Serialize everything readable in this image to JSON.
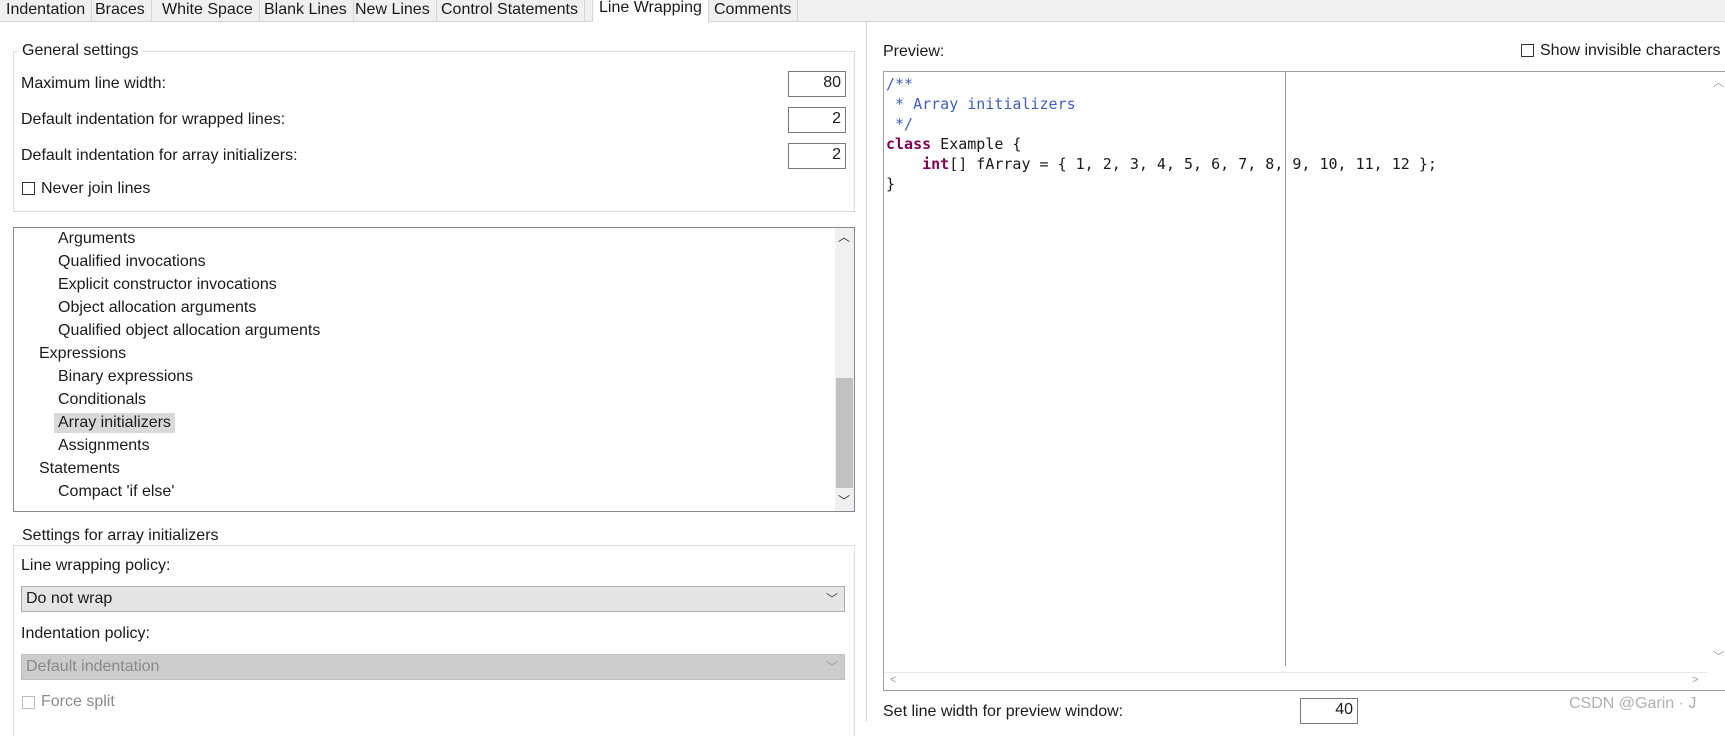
{
  "tabs": [
    {
      "label": "Indentation"
    },
    {
      "label": "Braces"
    },
    {
      "label": "White Space"
    },
    {
      "label": "Blank Lines"
    },
    {
      "label": "New Lines"
    },
    {
      "label": "Control Statements"
    },
    {
      "label": "Line Wrapping"
    },
    {
      "label": "Comments"
    }
  ],
  "active_tab": "Line Wrapping",
  "general": {
    "title": "General settings",
    "max_width_label": "Maximum line width:",
    "max_width_value": "80",
    "wrapped_indent_label": "Default indentation for wrapped lines:",
    "wrapped_indent_value": "2",
    "array_indent_label": "Default indentation for array initializers:",
    "array_indent_value": "2",
    "never_join_label": "Never join lines",
    "never_join_checked": false
  },
  "tree": {
    "items": [
      {
        "label": "Arguments",
        "level": 2
      },
      {
        "label": "Qualified invocations",
        "level": 2
      },
      {
        "label": "Explicit constructor invocations",
        "level": 2
      },
      {
        "label": "Object allocation arguments",
        "level": 2
      },
      {
        "label": "Qualified object allocation arguments",
        "level": 2
      },
      {
        "label": "Expressions",
        "level": 1
      },
      {
        "label": "Binary expressions",
        "level": 2
      },
      {
        "label": "Conditionals",
        "level": 2
      },
      {
        "label": "Array initializers",
        "level": 2,
        "selected": true
      },
      {
        "label": "Assignments",
        "level": 2
      },
      {
        "label": "Statements",
        "level": 1
      },
      {
        "label": "Compact 'if else'",
        "level": 2
      }
    ]
  },
  "array_settings": {
    "title": "Settings for array initializers",
    "policy_label": "Line wrapping policy:",
    "policy_value": "Do not wrap",
    "indent_policy_label": "Indentation policy:",
    "indent_policy_value": "Default indentation",
    "force_split_label": "Force split"
  },
  "preview": {
    "label": "Preview:",
    "show_invisible_label": "Show invisible characters",
    "code": {
      "c1": "/**",
      "c2": " * Array initializers",
      "c3": " */",
      "kw_class": "class",
      "class_rest": " Example {",
      "indent": "    ",
      "kw_int": "int",
      "int_rest": "[] fArray = { 1, 2, 3, 4, 5, 6, 7, 8, 9, 10, 11, 12 };",
      "close": "}"
    },
    "line_width_label": "Set line width for preview window:",
    "line_width_value": "40"
  },
  "watermark": "CSDN @Garin · J"
}
